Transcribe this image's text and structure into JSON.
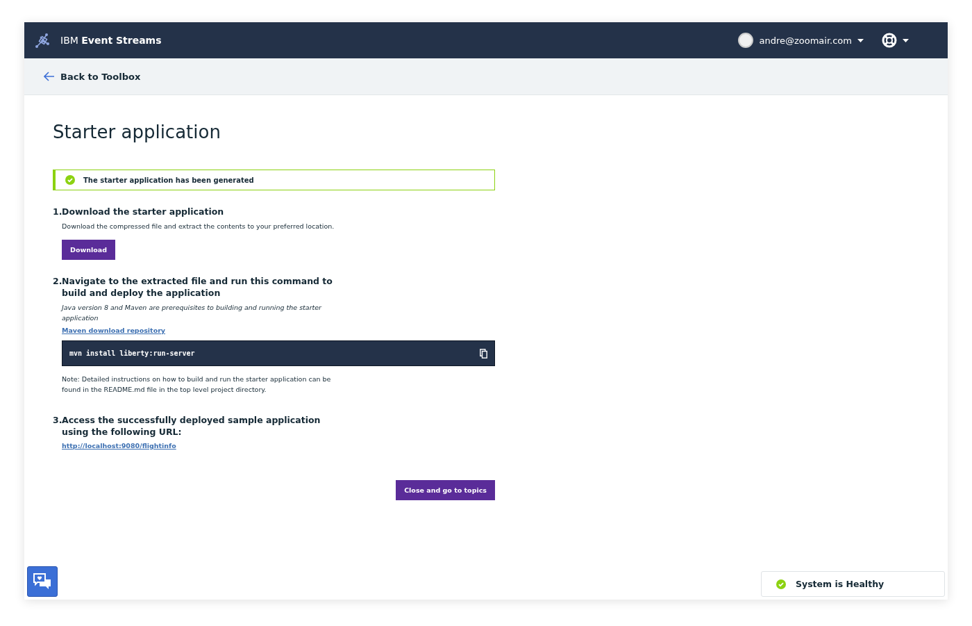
{
  "header": {
    "product": "IBM **Event Streams**",
    "user": "andre@zoomair.com"
  },
  "back_link": "Back to Toolbox",
  "title": "Starter application",
  "notification": {
    "kind": "success",
    "text": "The starter application has been generated"
  },
  "steps": [
    {
      "number": "1.",
      "title": "Download the starter application",
      "description": "Download the compressed file and extract the contents to your preferred location.",
      "button": "Download"
    },
    {
      "number": "2.",
      "title": "Navigate to the extracted file and run this command to build and deploy the application",
      "prerequisite": "Java version 8 and Maven are prerequisites to building and running the starter application",
      "link": "Maven download repository",
      "command": "mvn install liberty:run-server",
      "note": "Note: Detailed instructions on how to build and run the starter application can be found in the README.md file in the top level project directory."
    },
    {
      "number": "3.",
      "title": "Access the successfully deployed sample application using the following URL:",
      "link": "http://localhost:9080/flightinfo"
    }
  ],
  "primary_action": "Close and go to topics",
  "status": {
    "kind": "healthy",
    "text": "System is Healthy"
  }
}
